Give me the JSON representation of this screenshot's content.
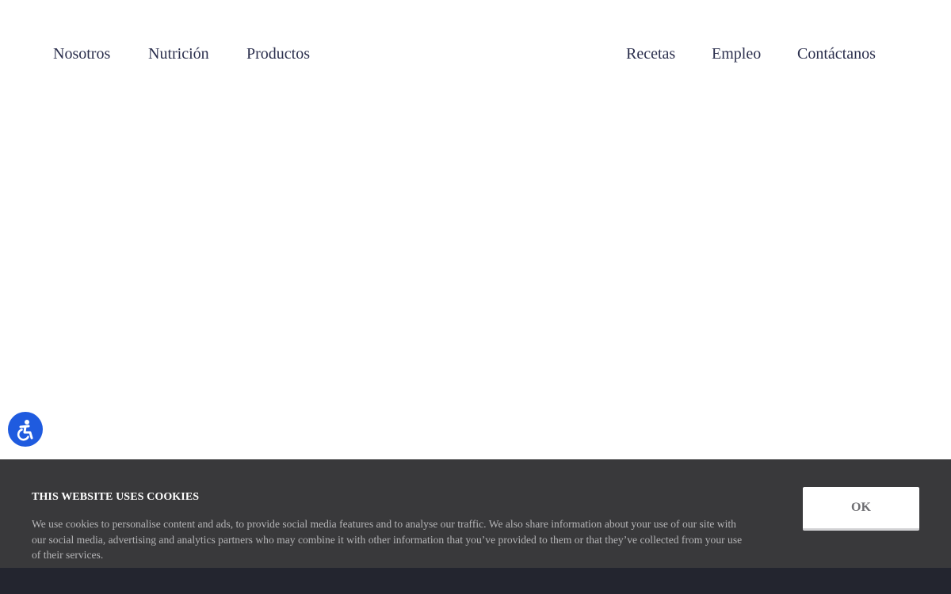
{
  "nav": {
    "left": [
      {
        "label": "Nosotros"
      },
      {
        "label": "Nutrición"
      },
      {
        "label": "Productos"
      }
    ],
    "right": [
      {
        "label": "Recetas"
      },
      {
        "label": "Empleo"
      },
      {
        "label": "Contáctanos"
      }
    ],
    "link_color": "#2b2f4d"
  },
  "accessibility": {
    "icon": "accessibility-icon",
    "color": "#1f5bdf"
  },
  "cookie_banner": {
    "title": "THIS WEBSITE USES COOKIES",
    "text": "We use cookies to personalise content and ads, to provide social media features and to analyse our traffic. We also share information about your use of our site with our social media, advertising and analytics partners who may combine it with other information that you’ve provided to them or that they’ve collected from your use of their services.",
    "ok_label": "OK",
    "background": "#39393b"
  }
}
